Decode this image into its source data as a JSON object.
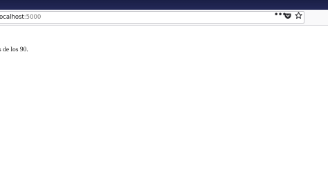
{
  "browser": {
    "url": {
      "host": "ocalhost",
      "port": ":5000"
    },
    "icons": {
      "page_actions": "more-horizontal-icon",
      "pocket": "pocket-icon",
      "bookmark": "star-icon"
    },
    "page_actions_glyph": "•••"
  },
  "page": {
    "text": "s de los 90."
  }
}
